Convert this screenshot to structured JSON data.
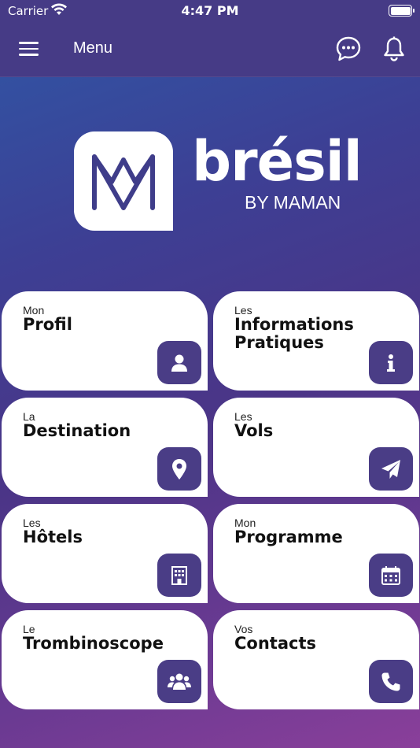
{
  "status_bar": {
    "carrier": "Carrier",
    "time": "4:47 PM"
  },
  "header": {
    "title": "Menu",
    "icons": [
      "menu-icon",
      "chat-icon",
      "bell-icon"
    ]
  },
  "brand": {
    "name": "brésil",
    "subtitle": "BY MAMAN"
  },
  "colors": {
    "header": "#463b86",
    "accent": "#4a3d86",
    "card": "#ffffff"
  },
  "cards": [
    {
      "small": "Mon",
      "big": "Profil",
      "icon": "user-icon"
    },
    {
      "small": "Les",
      "big": "Informations Pratiques",
      "icon": "info-icon"
    },
    {
      "small": "La",
      "big": "Destination",
      "icon": "map-pin-icon"
    },
    {
      "small": "Les",
      "big": "Vols",
      "icon": "paper-plane-icon"
    },
    {
      "small": "Les",
      "big": "Hôtels",
      "icon": "building-icon"
    },
    {
      "small": "Mon",
      "big": "Programme",
      "icon": "calendar-icon"
    },
    {
      "small": "Le",
      "big": "Trombinoscope",
      "icon": "users-icon"
    },
    {
      "small": "Vos",
      "big": "Contacts",
      "icon": "phone-icon"
    }
  ]
}
